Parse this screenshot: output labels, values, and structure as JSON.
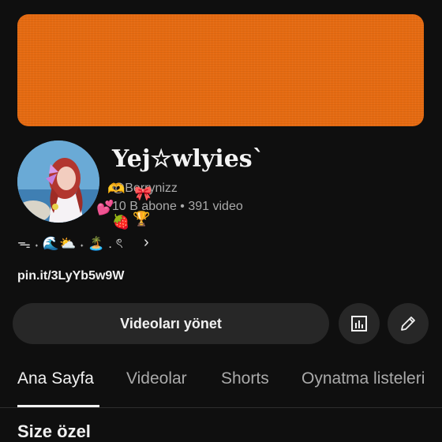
{
  "channel": {
    "name": "Yej☆wlyies`",
    "handle": "@Berrynizz",
    "stats": "10 B abone • 391 video",
    "description": "ᯓ ˖ 🌊⛅ ˖ 🏝️ . ৎ",
    "link": "pin.it/3LyYb5w9W",
    "banner_color": "#e66b12"
  },
  "actions": {
    "manage_label": "Videoları yönet",
    "stats_icon": "analytics-icon",
    "edit_icon": "pencil-icon"
  },
  "tabs": [
    {
      "label": "Ana Sayfa",
      "active": true
    },
    {
      "label": "Videolar",
      "active": false
    },
    {
      "label": "Shorts",
      "active": false
    },
    {
      "label": "Oynatma listeleri",
      "active": false
    }
  ],
  "section": {
    "title": "Size özel"
  },
  "decorations": {
    "hands": "🫶",
    "bow": "🎀",
    "heart": "💕",
    "strawberry": "🍓",
    "trophy": "🏆"
  }
}
